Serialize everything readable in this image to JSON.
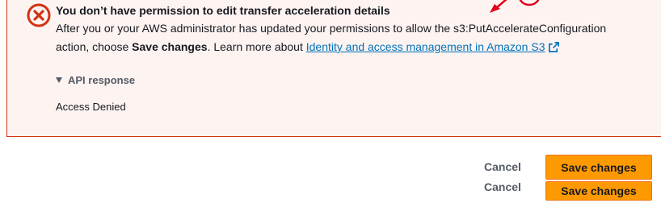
{
  "alert": {
    "title": "You don’t have permission to edit transfer acceleration details",
    "line1": "After you or your AWS administrator has updated your permissions to allow the s3:PutAccelerateConfiguration",
    "line2_prefix": "action, choose ",
    "line2_bold": "Save changes",
    "line2_mid": ". Learn more about ",
    "link_text": "Identity and access management in Amazon S3",
    "icon": "error-circle-x-icon",
    "external_icon": "external-link-icon",
    "api_response_label": "API response",
    "api_response_text": "Access Denied",
    "colors": {
      "background": "#fdf3f1",
      "border": "#d13212",
      "link": "#0073bb"
    }
  },
  "actions": [
    {
      "cancel_label": "Cancel",
      "save_label": "Save changes"
    },
    {
      "cancel_label": "Cancel",
      "save_label": "Save changes"
    }
  ],
  "colors": {
    "primary_button": "#ff9900",
    "annotation_arrow": "#e0001b"
  }
}
